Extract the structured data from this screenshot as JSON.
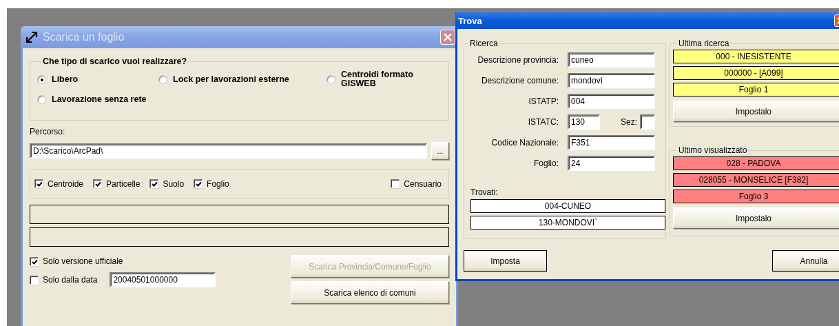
{
  "scarica": {
    "title": "Scarica un foglio",
    "group_title": "Che tipo di scarico vuoi realizzare?",
    "options": [
      {
        "label": "Libero",
        "selected": true
      },
      {
        "label": "Lock per lavorazioni esterne",
        "selected": false
      },
      {
        "label": "Centroidi formato GISWEB",
        "selected": false
      },
      {
        "label": "Lavorazione senza rete",
        "selected": false
      }
    ],
    "path_label": "Percorso:",
    "path_value": "D:\\Scarico\\ArcPad\\",
    "browse_label": "...",
    "layers": [
      {
        "label": "Centroide",
        "checked": true
      },
      {
        "label": "Particelle",
        "checked": true
      },
      {
        "label": "Suolo",
        "checked": true
      },
      {
        "label": "Foglio",
        "checked": true
      }
    ],
    "censuario": {
      "label": "Censuario",
      "checked": false
    },
    "solo_versione": {
      "label": "Solo versione ufficiale",
      "checked": true
    },
    "solo_data": {
      "label": "Solo dalla data",
      "checked": false,
      "value": "20040501000000"
    },
    "buttons": [
      {
        "label": "Scarica Provincia/Comune/Foglio",
        "disabled": true
      },
      {
        "label": "Scarica elenco di comuni",
        "disabled": false
      }
    ]
  },
  "trova": {
    "title": "Trova",
    "search_title": "Ricerca",
    "fields": [
      {
        "label": "Descrizione provincia:",
        "value": "cuneo"
      },
      {
        "label": "Descrizione comune:",
        "value": "mondovì"
      },
      {
        "label": "ISTATP:",
        "value": "004"
      },
      {
        "label": "ISTATC:",
        "value": "130",
        "extra": {
          "label": "Sez:"
        }
      },
      {
        "label": "Codice Nazionale:",
        "value": "F351"
      },
      {
        "label": "Foglio:",
        "value": "24"
      }
    ],
    "found_label": "Trovati:",
    "found": [
      "004-CUNEO",
      "130-MONDOVI`"
    ],
    "history": [
      {
        "title": "Ultima ricerca",
        "color": "#ffff80",
        "entries": [
          "000 - INESISTENTE",
          "000000 -  [A099]",
          "Foglio 1"
        ],
        "button": "Impostalo"
      },
      {
        "title": "Ultimo visualizzato",
        "color": "#ff8080",
        "entries": [
          "028 - PADOVA",
          "028055 - MONSELICE [F382]",
          "Foglio 3"
        ],
        "button": "Impostalo"
      }
    ],
    "buttons": [
      "Imposta",
      "Annulla"
    ]
  }
}
